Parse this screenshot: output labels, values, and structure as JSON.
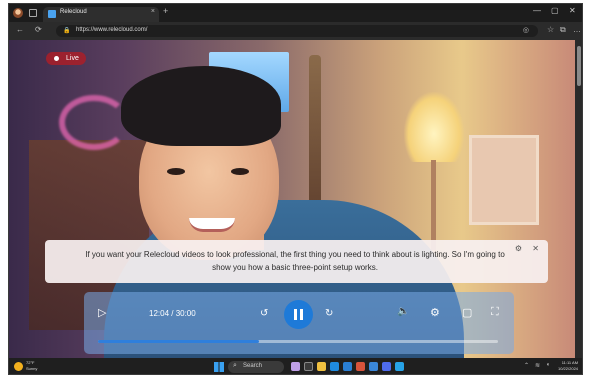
{
  "browser": {
    "tab_title": "Relecloud",
    "tab_close": "×",
    "new_tab": "+",
    "minimize": "—",
    "maximize": "▢",
    "close": "✕",
    "back": "←",
    "refresh": "⟳",
    "url": "https://www.relecloud.com/",
    "accent": "#4aa3f0"
  },
  "video": {
    "live_label": "Live",
    "caption": "If you want your Relecloud videos to look professional, the first thing you need to think about is lighting. So I'm going to show you how a basic three-point setup works.",
    "caption_settings_icon": "⚙",
    "caption_close_icon": "✕",
    "player": {
      "play_icon": "▷",
      "time": "12:04 / 30:00",
      "rewind_icon": "↺",
      "forward_icon": "↻",
      "volume_icon": "🔈",
      "settings_icon": "⚙",
      "theater_icon": "▢",
      "fullscreen_icon": "⛶",
      "progress_fraction": 0.402,
      "accent": "#1e7ad8"
    }
  },
  "taskbar": {
    "weather_line1": "72°F",
    "weather_line2": "Sunny",
    "search_label": "Search",
    "time": "11:11 AM",
    "date": "10/22/2024"
  }
}
